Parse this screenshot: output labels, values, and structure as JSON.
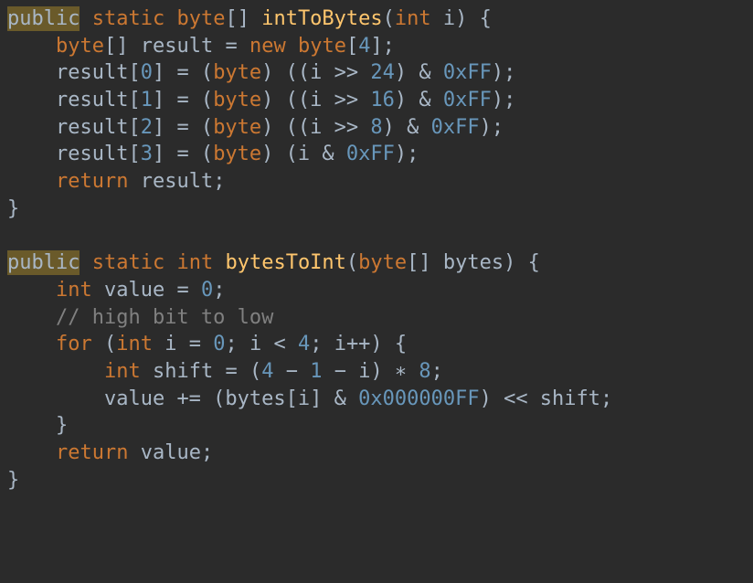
{
  "code": {
    "method1": {
      "signature": {
        "public": "public",
        "static": "static",
        "ret": "byte",
        "brk": "[]",
        "name": "intToBytes",
        "paramType": "int",
        "paramName": "i"
      },
      "line2": {
        "type": "byte",
        "brk": "[]",
        "var": "result",
        "eq": "=",
        "new": "new",
        "ntype": "byte",
        "size": "4"
      },
      "l3": {
        "idx": "0",
        "shift": "24",
        "mask": "0xFF"
      },
      "l4": {
        "idx": "1",
        "shift": "16",
        "mask": "0xFF"
      },
      "l5": {
        "idx": "2",
        "shift": "8",
        "mask": "0xFF"
      },
      "l6": {
        "idx": "3",
        "mask": "0xFF"
      },
      "ret": {
        "kw": "return",
        "var": "result"
      }
    },
    "method2": {
      "signature": {
        "public": "public",
        "static": "static",
        "ret": "int",
        "name": "bytesToInt",
        "paramType": "byte",
        "brk": "[]",
        "paramName": "bytes"
      },
      "line2": {
        "type": "int",
        "var": "value",
        "eq": "=",
        "zero": "0"
      },
      "comment": "// high bit to low",
      "forLine": {
        "for": "for",
        "int": "int",
        "i": "i",
        "zero": "0",
        "lt4": "4",
        "ipp": "i++"
      },
      "shiftLine": {
        "int": "int",
        "var": "shift",
        "four": "4",
        "one": "1",
        "i": "i",
        "eight": "8"
      },
      "valLine": {
        "mask": "0x000000FF"
      },
      "ret": {
        "kw": "return",
        "var": "value"
      }
    }
  }
}
